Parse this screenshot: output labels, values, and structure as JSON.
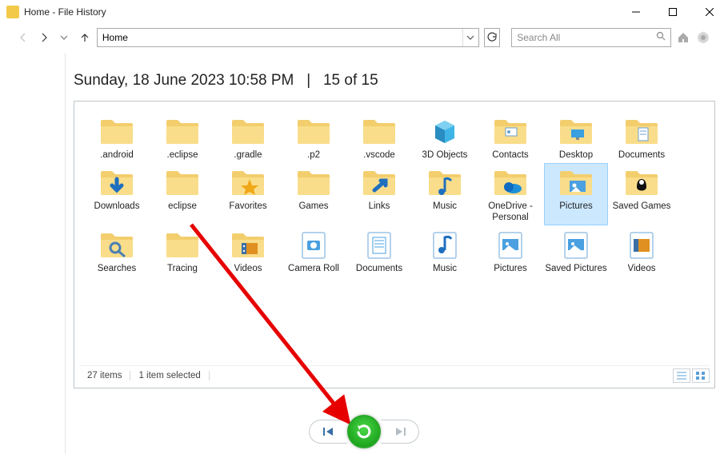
{
  "window": {
    "title": "Home - File History"
  },
  "toolbar": {
    "address": "Home",
    "search_placeholder": "Search All"
  },
  "header": {
    "date_label": "Sunday, 18 June 2023 10:58 PM",
    "sep": "|",
    "position": "15 of 15"
  },
  "status": {
    "count": "27 items",
    "selection": "1 item selected"
  },
  "items": [
    {
      "label": ".android",
      "kind": "folder"
    },
    {
      "label": ".eclipse",
      "kind": "folder"
    },
    {
      "label": ".gradle",
      "kind": "folder"
    },
    {
      "label": ".p2",
      "kind": "folder"
    },
    {
      "label": ".vscode",
      "kind": "folder"
    },
    {
      "label": "3D Objects",
      "kind": "folder-3d"
    },
    {
      "label": "Contacts",
      "kind": "folder-contacts"
    },
    {
      "label": "Desktop",
      "kind": "folder-desktop"
    },
    {
      "label": "Documents",
      "kind": "folder-doc"
    },
    {
      "label": "Downloads",
      "kind": "folder-download"
    },
    {
      "label": "eclipse",
      "kind": "folder"
    },
    {
      "label": "Favorites",
      "kind": "folder-fav"
    },
    {
      "label": "Games",
      "kind": "folder"
    },
    {
      "label": "Links",
      "kind": "folder-links"
    },
    {
      "label": "Music",
      "kind": "folder-music"
    },
    {
      "label": "OneDrive - Personal",
      "kind": "folder-onedrive"
    },
    {
      "label": "Pictures",
      "kind": "folder-pics",
      "selected": true
    },
    {
      "label": "Saved Games",
      "kind": "folder-games"
    },
    {
      "label": "Searches",
      "kind": "folder-search"
    },
    {
      "label": "Tracing",
      "kind": "folder"
    },
    {
      "label": "Videos",
      "kind": "folder-video"
    },
    {
      "label": "Camera Roll",
      "kind": "lib-camera"
    },
    {
      "label": "Documents",
      "kind": "lib-doc"
    },
    {
      "label": "Music",
      "kind": "lib-music"
    },
    {
      "label": "Pictures",
      "kind": "lib-pics"
    },
    {
      "label": "Saved Pictures",
      "kind": "lib-pics"
    },
    {
      "label": "Videos",
      "kind": "lib-video"
    }
  ],
  "controls": {
    "prev": "Previous version",
    "restore": "Restore",
    "next": "Next version"
  },
  "colors": {
    "accent_restore": "#28b528",
    "selection": "#cce8ff"
  }
}
